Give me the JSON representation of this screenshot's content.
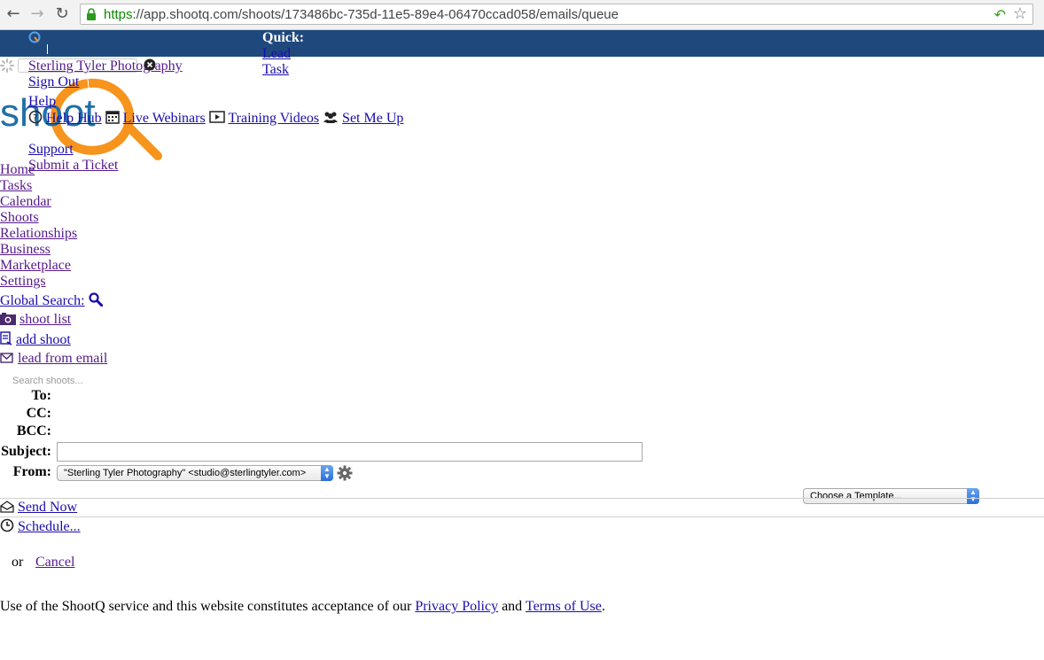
{
  "browser": {
    "url_scheme": "https",
    "url_rest": "://app.shootq.com/shoots/173486bc-735d-11e5-89e4-06470ccad058/emails/queue",
    "back_icon": "back-arrow-icon",
    "forward_icon": "forward-arrow-icon",
    "reload_icon": "reload-icon"
  },
  "header": {
    "quick_label": "Quick:",
    "quick_links": [
      "Lead",
      "Task"
    ],
    "account_name": "Sterling Tyler Photography",
    "sign_out": "Sign Out",
    "help_label": "Help",
    "help_links": [
      "Help Hub",
      "Live Webinars",
      "Training Videos",
      "Set Me Up"
    ],
    "support_label": "Support",
    "submit_ticket": "Submit a Ticket",
    "brand_color": "#1f497d",
    "logo_text": "shootQ"
  },
  "nav": {
    "items": [
      "Home",
      "Tasks",
      "Calendar",
      "Shoots",
      "Relationships",
      "Business",
      "Marketplace",
      "Settings"
    ],
    "global_search": "Global Search:",
    "shoot_list": "shoot list",
    "add_shoot": "add shoot",
    "lead_from_email": "lead from email",
    "search_placeholder": "Search shoots..."
  },
  "email_form": {
    "to_label": "To:",
    "cc_label": "CC:",
    "bcc_label": "BCC:",
    "subject_label": "Subject:",
    "subject_value": "",
    "from_label": "From:",
    "from_value": "\"Sterling Tyler Photography\" <studio@sterlingtyler.com>",
    "template_value": "Choose a Template..."
  },
  "actions": {
    "send_now": "Send Now",
    "schedule": "Schedule...",
    "or_text": "or",
    "cancel": "Cancel"
  },
  "footer": {
    "text_before": "Use of the ShootQ service and this website constitutes acceptance of our",
    "privacy": "Privacy Policy",
    "and": "and",
    "terms": "Terms of Use",
    "period": "."
  }
}
